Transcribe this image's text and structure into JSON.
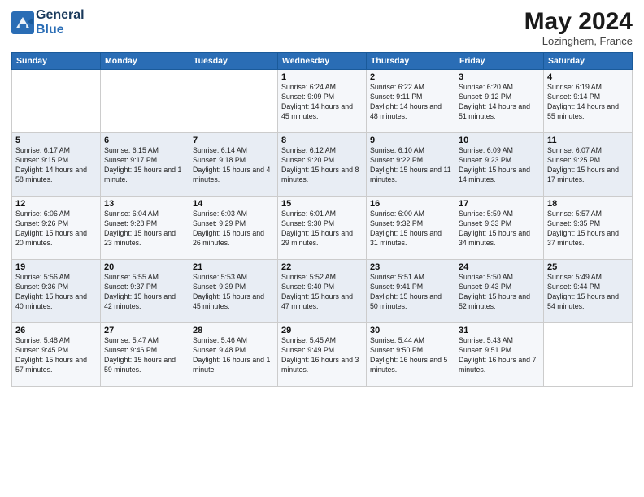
{
  "header": {
    "logo_line1": "General",
    "logo_line2": "Blue",
    "month_year": "May 2024",
    "location": "Lozinghem, France"
  },
  "days_of_week": [
    "Sunday",
    "Monday",
    "Tuesday",
    "Wednesday",
    "Thursday",
    "Friday",
    "Saturday"
  ],
  "weeks": [
    [
      {
        "day": null
      },
      {
        "day": null
      },
      {
        "day": null
      },
      {
        "day": "1",
        "sunrise": "6:24 AM",
        "sunset": "9:09 PM",
        "daylight": "14 hours and 45 minutes."
      },
      {
        "day": "2",
        "sunrise": "6:22 AM",
        "sunset": "9:11 PM",
        "daylight": "14 hours and 48 minutes."
      },
      {
        "day": "3",
        "sunrise": "6:20 AM",
        "sunset": "9:12 PM",
        "daylight": "14 hours and 51 minutes."
      },
      {
        "day": "4",
        "sunrise": "6:19 AM",
        "sunset": "9:14 PM",
        "daylight": "14 hours and 55 minutes."
      }
    ],
    [
      {
        "day": "5",
        "sunrise": "6:17 AM",
        "sunset": "9:15 PM",
        "daylight": "14 hours and 58 minutes."
      },
      {
        "day": "6",
        "sunrise": "6:15 AM",
        "sunset": "9:17 PM",
        "daylight": "15 hours and 1 minute."
      },
      {
        "day": "7",
        "sunrise": "6:14 AM",
        "sunset": "9:18 PM",
        "daylight": "15 hours and 4 minutes."
      },
      {
        "day": "8",
        "sunrise": "6:12 AM",
        "sunset": "9:20 PM",
        "daylight": "15 hours and 8 minutes."
      },
      {
        "day": "9",
        "sunrise": "6:10 AM",
        "sunset": "9:22 PM",
        "daylight": "15 hours and 11 minutes."
      },
      {
        "day": "10",
        "sunrise": "6:09 AM",
        "sunset": "9:23 PM",
        "daylight": "15 hours and 14 minutes."
      },
      {
        "day": "11",
        "sunrise": "6:07 AM",
        "sunset": "9:25 PM",
        "daylight": "15 hours and 17 minutes."
      }
    ],
    [
      {
        "day": "12",
        "sunrise": "6:06 AM",
        "sunset": "9:26 PM",
        "daylight": "15 hours and 20 minutes."
      },
      {
        "day": "13",
        "sunrise": "6:04 AM",
        "sunset": "9:28 PM",
        "daylight": "15 hours and 23 minutes."
      },
      {
        "day": "14",
        "sunrise": "6:03 AM",
        "sunset": "9:29 PM",
        "daylight": "15 hours and 26 minutes."
      },
      {
        "day": "15",
        "sunrise": "6:01 AM",
        "sunset": "9:30 PM",
        "daylight": "15 hours and 29 minutes."
      },
      {
        "day": "16",
        "sunrise": "6:00 AM",
        "sunset": "9:32 PM",
        "daylight": "15 hours and 31 minutes."
      },
      {
        "day": "17",
        "sunrise": "5:59 AM",
        "sunset": "9:33 PM",
        "daylight": "15 hours and 34 minutes."
      },
      {
        "day": "18",
        "sunrise": "5:57 AM",
        "sunset": "9:35 PM",
        "daylight": "15 hours and 37 minutes."
      }
    ],
    [
      {
        "day": "19",
        "sunrise": "5:56 AM",
        "sunset": "9:36 PM",
        "daylight": "15 hours and 40 minutes."
      },
      {
        "day": "20",
        "sunrise": "5:55 AM",
        "sunset": "9:37 PM",
        "daylight": "15 hours and 42 minutes."
      },
      {
        "day": "21",
        "sunrise": "5:53 AM",
        "sunset": "9:39 PM",
        "daylight": "15 hours and 45 minutes."
      },
      {
        "day": "22",
        "sunrise": "5:52 AM",
        "sunset": "9:40 PM",
        "daylight": "15 hours and 47 minutes."
      },
      {
        "day": "23",
        "sunrise": "5:51 AM",
        "sunset": "9:41 PM",
        "daylight": "15 hours and 50 minutes."
      },
      {
        "day": "24",
        "sunrise": "5:50 AM",
        "sunset": "9:43 PM",
        "daylight": "15 hours and 52 minutes."
      },
      {
        "day": "25",
        "sunrise": "5:49 AM",
        "sunset": "9:44 PM",
        "daylight": "15 hours and 54 minutes."
      }
    ],
    [
      {
        "day": "26",
        "sunrise": "5:48 AM",
        "sunset": "9:45 PM",
        "daylight": "15 hours and 57 minutes."
      },
      {
        "day": "27",
        "sunrise": "5:47 AM",
        "sunset": "9:46 PM",
        "daylight": "15 hours and 59 minutes."
      },
      {
        "day": "28",
        "sunrise": "5:46 AM",
        "sunset": "9:48 PM",
        "daylight": "16 hours and 1 minute."
      },
      {
        "day": "29",
        "sunrise": "5:45 AM",
        "sunset": "9:49 PM",
        "daylight": "16 hours and 3 minutes."
      },
      {
        "day": "30",
        "sunrise": "5:44 AM",
        "sunset": "9:50 PM",
        "daylight": "16 hours and 5 minutes."
      },
      {
        "day": "31",
        "sunrise": "5:43 AM",
        "sunset": "9:51 PM",
        "daylight": "16 hours and 7 minutes."
      },
      {
        "day": null
      }
    ]
  ]
}
